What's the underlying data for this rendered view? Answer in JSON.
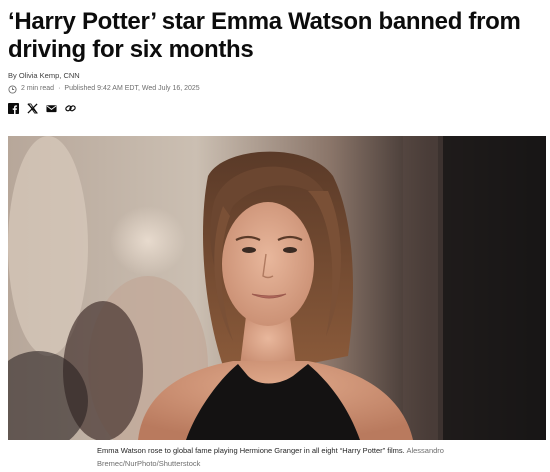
{
  "article": {
    "headline": "‘Harry Potter’ star Emma Watson banned from driving for six months",
    "byline_prefix": "By ",
    "author": "Olivia Kemp, CNN",
    "read_time": "2 min read",
    "separator": "·",
    "published": "Published 9:42 AM EDT, Wed July 16, 2025"
  },
  "share": {
    "icons": [
      "facebook-icon",
      "x-icon",
      "email-icon",
      "link-icon"
    ]
  },
  "photo": {
    "caption": "Emma Watson rose to global fame playing Hermione Granger in all eight “Harry Potter” films.",
    "credit_line1": "Alessandro",
    "credit_line2": "Bremec/NurPhoto/Shutterstock"
  },
  "colors": {
    "text": "#0c0c0c",
    "meta": "#6e6e6e",
    "caption": "#262626"
  }
}
